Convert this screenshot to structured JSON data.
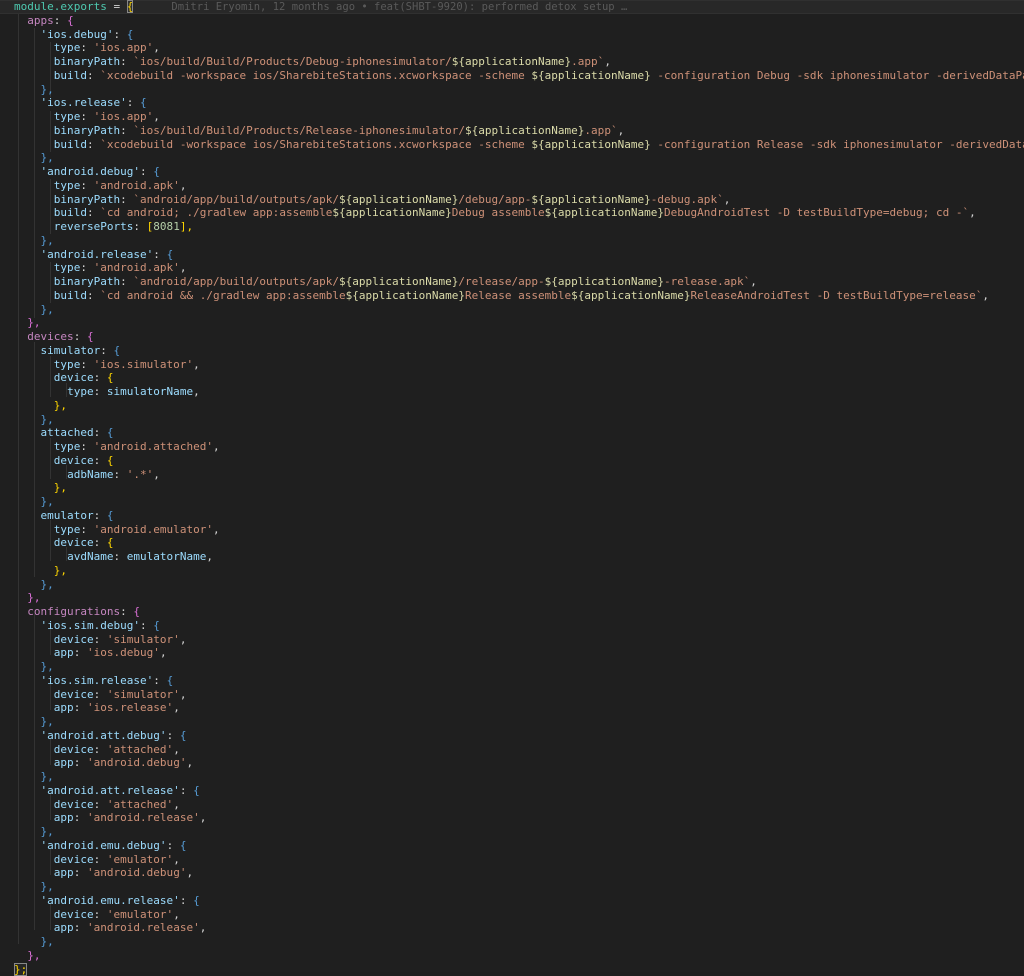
{
  "editor": {
    "name": "code-editor",
    "language": "javascript",
    "theme": "dark-plus",
    "background": "#1f1f1f",
    "active_line_background": "#282828",
    "colors": {
      "keyword": "#4ec9b0",
      "top_level_key": "#c586c0",
      "identifier": "#9cdcfe",
      "string": "#ce9178",
      "number": "#b5cea8",
      "punctuation": "#d4d4d4",
      "bracket_yellow": "#ffd700",
      "bracket_purple": "#da70d6",
      "bracket_blue": "#569cd6",
      "blame_text": "#5a5a5a",
      "indent_guide": "#333333",
      "gutter_change_marker": "#6b2a2a"
    }
  },
  "blame": {
    "author": "Dmitri Eryomin",
    "age": "12 months ago",
    "separator": "•",
    "message": "feat(SHBT-9920): performed detox setup …",
    "full": "Dmitri Eryomin, 12 months ago • feat(SHBT-9920): performed detox setup …"
  },
  "code": {
    "line01": {
      "head": "module.exports",
      "eq": " = ",
      "brace": "{"
    },
    "apps_key": "apps",
    "ios_debug_key": "'ios.debug'",
    "ios_debug_type_key": "type",
    "ios_debug_type_val": "'ios.app'",
    "ios_debug_binarypath_key": "binaryPath",
    "ios_debug_binarypath_a": "`ios/build/Build/Products/Debug-iphonesimulator/",
    "ios_debug_binarypath_expr": "${applicationName}",
    "ios_debug_binarypath_b": ".app`",
    "ios_debug_build_key": "build",
    "ios_debug_build_a": "`xcodebuild -workspace ios/SharebiteStations.xcworkspace -scheme ",
    "ios_debug_build_expr": "${applicationName}",
    "ios_debug_build_b": " -configuration Debug -sdk iphonesimulator -derivedDataPath ios/build`",
    "ios_release_key": "'ios.release'",
    "ios_release_type_key": "type",
    "ios_release_type_val": "'ios.app'",
    "ios_release_binarypath_key": "binaryPath",
    "ios_release_binarypath_a": "`ios/build/Build/Products/Release-iphonesimulator/",
    "ios_release_binarypath_expr": "${applicationName}",
    "ios_release_binarypath_b": ".app`",
    "ios_release_build_key": "build",
    "ios_release_build_a": "`xcodebuild -workspace ios/SharebiteStations.xcworkspace -scheme ",
    "ios_release_build_expr": "${applicationName}",
    "ios_release_build_b": " -configuration Release -sdk iphonesimulator -derivedDataPath ios/build`",
    "android_debug_key": "'android.debug'",
    "android_debug_type_key": "type",
    "android_debug_type_val": "'android.apk'",
    "android_debug_binarypath_key": "binaryPath",
    "android_debug_binarypath_a": "`android/app/build/outputs/apk/",
    "android_debug_binarypath_expr1": "${applicationName}",
    "android_debug_binarypath_b": "/debug/app-",
    "android_debug_binarypath_expr2": "${applicationName}",
    "android_debug_binarypath_c": "-debug.apk`",
    "android_debug_build_key": "build",
    "android_debug_build_a": "`cd android; ./gradlew app:assemble",
    "android_debug_build_expr1": "${applicationName}",
    "android_debug_build_b": "Debug assemble",
    "android_debug_build_expr2": "${applicationName}",
    "android_debug_build_c": "DebugAndroidTest -D testBuildType=debug; cd -`",
    "android_debug_reverseports_key": "reversePorts",
    "android_debug_reverseports_val": "8081",
    "android_release_key": "'android.release'",
    "android_release_type_key": "type",
    "android_release_type_val": "'android.apk'",
    "android_release_binarypath_key": "binaryPath",
    "android_release_binarypath_a": "`android/app/build/outputs/apk/",
    "android_release_binarypath_expr1": "${applicationName}",
    "android_release_binarypath_b": "/release/app-",
    "android_release_binarypath_expr2": "${applicationName}",
    "android_release_binarypath_c": "-release.apk`",
    "android_release_build_key": "build",
    "android_release_build_a": "`cd android && ./gradlew app:assemble",
    "android_release_build_expr1": "${applicationName}",
    "android_release_build_b": "Release assemble",
    "android_release_build_expr2": "${applicationName}",
    "android_release_build_c": "ReleaseAndroidTest -D testBuildType=release`",
    "devices_key": "devices",
    "simulator_key": "simulator",
    "simulator_type_key": "type",
    "simulator_type_val": "'ios.simulator'",
    "simulator_device_key": "device",
    "simulator_device_type_key": "type",
    "simulator_device_type_val": "simulatorName",
    "attached_key": "attached",
    "attached_type_key": "type",
    "attached_type_val": "'android.attached'",
    "attached_device_key": "device",
    "attached_adbname_key": "adbName",
    "attached_adbname_val": "'.*'",
    "emulator_key": "emulator",
    "emulator_type_key": "type",
    "emulator_type_val": "'android.emulator'",
    "emulator_device_key": "device",
    "emulator_avdname_key": "avdName",
    "emulator_avdname_val": "emulatorName",
    "configurations_key": "configurations",
    "cfg1_key": "'ios.sim.debug'",
    "cfg1_device_key": "device",
    "cfg1_device_val": "'simulator'",
    "cfg1_app_key": "app",
    "cfg1_app_val": "'ios.debug'",
    "cfg2_key": "'ios.sim.release'",
    "cfg2_device_key": "device",
    "cfg2_device_val": "'simulator'",
    "cfg2_app_key": "app",
    "cfg2_app_val": "'ios.release'",
    "cfg3_key": "'android.att.debug'",
    "cfg3_device_key": "device",
    "cfg3_device_val": "'attached'",
    "cfg3_app_key": "app",
    "cfg3_app_val": "'android.debug'",
    "cfg4_key": "'android.att.release'",
    "cfg4_device_key": "device",
    "cfg4_device_val": "'attached'",
    "cfg4_app_key": "app",
    "cfg4_app_val": "'android.release'",
    "cfg5_key": "'android.emu.debug'",
    "cfg5_device_key": "device",
    "cfg5_device_val": "'emulator'",
    "cfg5_app_key": "app",
    "cfg5_app_val": "'android.debug'",
    "cfg6_key": "'android.emu.release'",
    "cfg6_device_key": "device",
    "cfg6_device_val": "'emulator'",
    "cfg6_app_key": "app",
    "cfg6_app_val": "'android.release'",
    "punc": {
      "colon": ":",
      "colon_sp": ": ",
      "comma": ",",
      "open_brace": "{",
      "close_brace": "}",
      "close_brace_comma": "},",
      "close_brace_semi": "};",
      "open_bracket": "[",
      "close_bracket_comma": "],"
    }
  }
}
